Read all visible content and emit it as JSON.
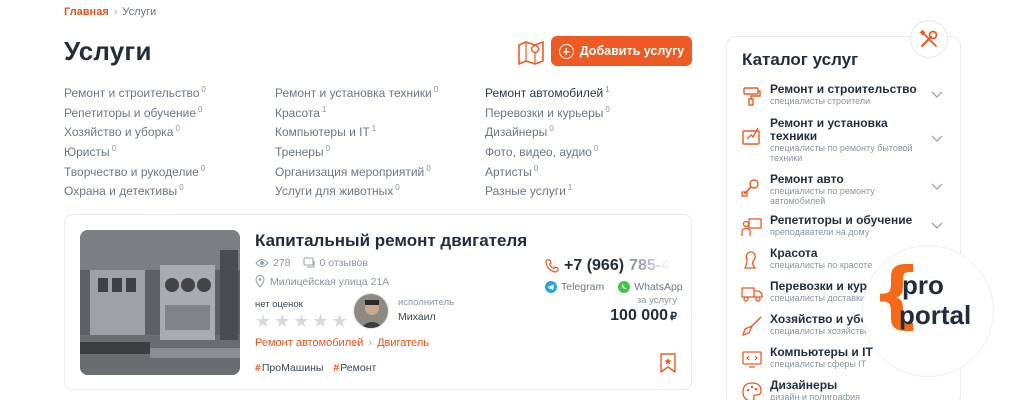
{
  "breadcrumb": {
    "home": "Главная",
    "current": "Услуги"
  },
  "page_title": "Услуги",
  "add_button": "Добавить услугу",
  "categories": [
    [
      {
        "label": "Ремонт и строительство",
        "count": "0"
      },
      {
        "label": "Ремонт и установка техники",
        "count": "0"
      },
      {
        "label": "Ремонт автомобилей",
        "count": "1"
      }
    ],
    [
      {
        "label": "Репетиторы и обучение",
        "count": "0"
      },
      {
        "label": "Красота",
        "count": "1"
      },
      {
        "label": "Перевозки и курьеры",
        "count": "0"
      }
    ],
    [
      {
        "label": "Хозяйство и уборка",
        "count": "0"
      },
      {
        "label": "Компьютеры и IT",
        "count": "1"
      },
      {
        "label": "Дизайнеры",
        "count": "0"
      }
    ],
    [
      {
        "label": "Юристы",
        "count": "0"
      },
      {
        "label": "Тренеры",
        "count": "0"
      },
      {
        "label": "Фото, видео, аудио",
        "count": "0"
      }
    ],
    [
      {
        "label": "Творчество и рукоделие",
        "count": "0"
      },
      {
        "label": "Организация мероприятий",
        "count": "0"
      },
      {
        "label": "Артисты",
        "count": "0"
      }
    ],
    [
      {
        "label": "Охрана и детективы",
        "count": "0"
      },
      {
        "label": "Услуги для животных",
        "count": "0"
      },
      {
        "label": "Разные услуги",
        "count": "1"
      }
    ]
  ],
  "listing": {
    "title": "Капитальный ремонт двигателя",
    "views": "278",
    "reviews": "0 отзывов",
    "address": "Милицейская улица 21А",
    "rating_label": "нет оценок",
    "performer_label": "исполнитель",
    "performer_name": "Михаил",
    "category": "Ремонт автомобилей",
    "subcategory": "Двигатель",
    "tags": [
      "ПроМашины",
      "Ремонт"
    ],
    "phone_visible": "+7 (966)",
    "phone_hidden": "785-4",
    "telegram": "Telegram",
    "whatsapp": "WhatsApp",
    "price_label": "за услугу",
    "price": "100 000",
    "currency": "₽",
    "stars_filled": 0,
    "stars_total": 5
  },
  "catalog": {
    "title": "Каталог услуг",
    "items": [
      {
        "title": "Ремонт и строительство",
        "sub": "специалисты строители",
        "icon": "paint-roller-icon"
      },
      {
        "title": "Ремонт и установка техники",
        "sub": "специалисты по ремонту бытовой техники",
        "icon": "tools-icon"
      },
      {
        "title": "Ремонт авто",
        "sub": "специалисты по ремонту автомобилей",
        "icon": "car-repair-icon"
      },
      {
        "title": "Репетиторы и обучение",
        "sub": "преподаватели на дому",
        "icon": "teacher-icon"
      },
      {
        "title": "Красота",
        "sub": "специалисты по красоте",
        "icon": "beauty-icon"
      },
      {
        "title": "Перевозки и курьеры",
        "sub": "специалисты доставки",
        "icon": "truck-icon"
      },
      {
        "title": "Хозяйство и уборка",
        "sub": "специалисты хозяйственных",
        "icon": "broom-icon"
      },
      {
        "title": "Компьютеры и IT",
        "sub": "специалисты сферы IT",
        "icon": "computer-icon"
      },
      {
        "title": "Дизайнеры",
        "sub": "дизайн и полиграфия",
        "icon": "palette-icon"
      }
    ]
  },
  "logo": {
    "line1": "pro",
    "line2": "portal",
    "brace": "{"
  },
  "colors": {
    "accent": "#ee5a24",
    "text": "#1f2d3d",
    "muted": "#8a95a3"
  }
}
